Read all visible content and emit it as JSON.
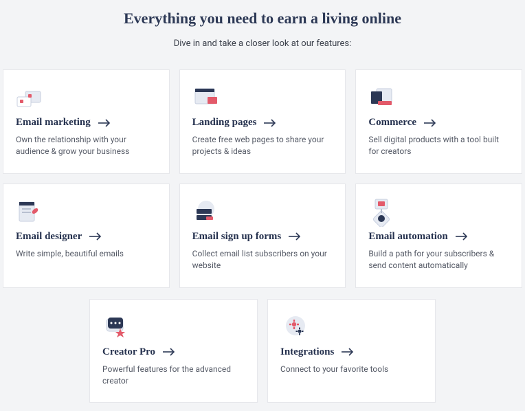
{
  "header": {
    "title": "Everything you need to earn a living online",
    "subtitle": "Dive in and take a closer look at our features:"
  },
  "icons": {
    "email_marketing": "email-marketing-icon",
    "landing_pages": "landing-pages-icon",
    "commerce": "commerce-icon",
    "email_designer": "email-designer-icon",
    "signup_forms": "signup-forms-icon",
    "automation": "automation-icon",
    "creator_pro": "creator-pro-icon",
    "integrations": "integrations-icon",
    "arrow": "arrow-right-icon"
  },
  "cards": [
    {
      "title": "Email marketing",
      "desc": "Own the relationship with your audience & grow your business"
    },
    {
      "title": "Landing pages",
      "desc": "Create free web pages to share your projects & ideas"
    },
    {
      "title": "Commerce",
      "desc": "Sell digital products with a tool built for creators"
    },
    {
      "title": "Email designer",
      "desc": "Write simple, beautiful emails"
    },
    {
      "title": "Email sign up forms",
      "desc": "Collect email list subscribers on your website"
    },
    {
      "title": "Email automation",
      "desc": "Build a path for your subscribers & send content automatically"
    },
    {
      "title": "Creator Pro",
      "desc": "Powerful features for the advanced creator"
    },
    {
      "title": "Integrations",
      "desc": "Connect to your favorite tools"
    }
  ],
  "colors": {
    "accent_red": "#e35a6a",
    "accent_navy": "#2c3855",
    "icon_soft": "#dfe4ef"
  }
}
